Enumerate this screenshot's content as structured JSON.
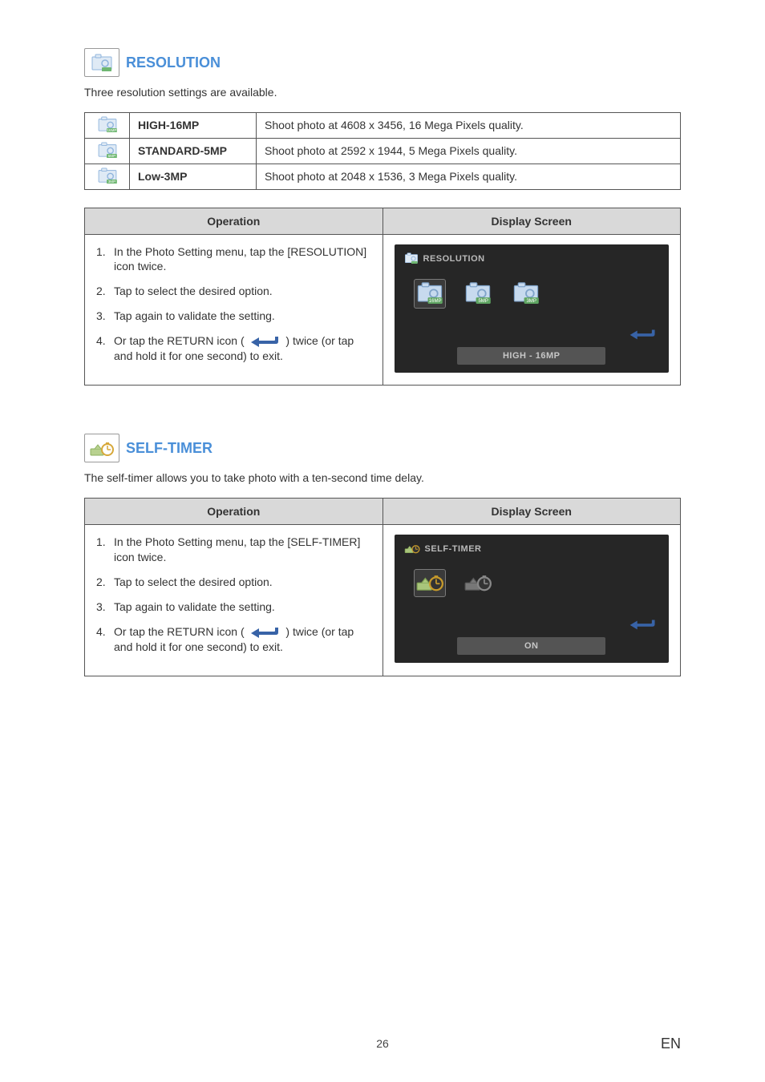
{
  "resolution": {
    "title": "RESOLUTION",
    "desc": "Three resolution settings are available.",
    "rows": [
      {
        "name": "HIGH-16MP",
        "desc": "Shoot photo at 4608 x 3456, 16 Mega Pixels quality."
      },
      {
        "name": "STANDARD-5MP",
        "desc": "Shoot photo at 2592 x 1944, 5 Mega Pixels quality."
      },
      {
        "name": "Low-3MP",
        "desc": "Shoot photo at 2048 x 1536, 3 Mega Pixels quality."
      }
    ],
    "headers": {
      "operation": "Operation",
      "display": "Display Screen"
    },
    "steps": {
      "s1": "In the Photo Setting menu, tap the [RESOLUTION] icon twice.",
      "s2": "Tap to select the desired option.",
      "s3": "Tap again to validate the setting.",
      "s4a": "Or tap the RETURN icon (",
      "s4b": ") twice (or tap and hold it for one second) to exit."
    },
    "screen": {
      "title": "RESOLUTION",
      "badges": [
        "16MP",
        "5MP",
        "3MP"
      ],
      "status": "HIGH - 16MP"
    }
  },
  "selftimer": {
    "title": "SELF-TIMER",
    "desc": "The self-timer allows you to take photo with a ten-second time delay.",
    "headers": {
      "operation": "Operation",
      "display": "Display Screen"
    },
    "steps": {
      "s1": "In the Photo Setting menu, tap the [SELF-TIMER] icon twice.",
      "s2": "Tap to select the desired option.",
      "s3": "Tap again to validate the setting.",
      "s4a": "Or tap the RETURN icon (",
      "s4b": ") twice (or tap and hold it for one second) to exit."
    },
    "screen": {
      "title": "SELF-TIMER",
      "status": "ON"
    }
  },
  "footer": {
    "page": "26",
    "lang": "EN"
  }
}
